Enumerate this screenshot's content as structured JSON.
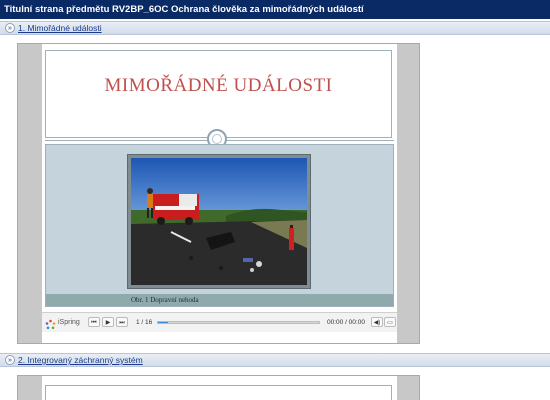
{
  "window": {
    "title": "Titulní strana předmětu RV2BP_6OC Ochrana člověka za mimořádných událostí"
  },
  "sections": [
    {
      "toggle": "»",
      "title": "1. Mimořádné události",
      "slide": {
        "heading": "MIMOŘÁDNÉ UDÁLOSTI",
        "image": "road-accident-photo",
        "caption": "Obr. 1  Dopravní nehoda"
      },
      "player": {
        "logo": "iSpring",
        "slide_counter": "1 / 16",
        "progress": 0.06,
        "time": "00:00 / 00:00"
      }
    },
    {
      "toggle": "»",
      "title": "2. Integrovaný záchranný systém"
    }
  ],
  "colors": {
    "titlebar": "#0a2a66",
    "heading": "#c0504d",
    "progress": "#3d8bd8"
  }
}
